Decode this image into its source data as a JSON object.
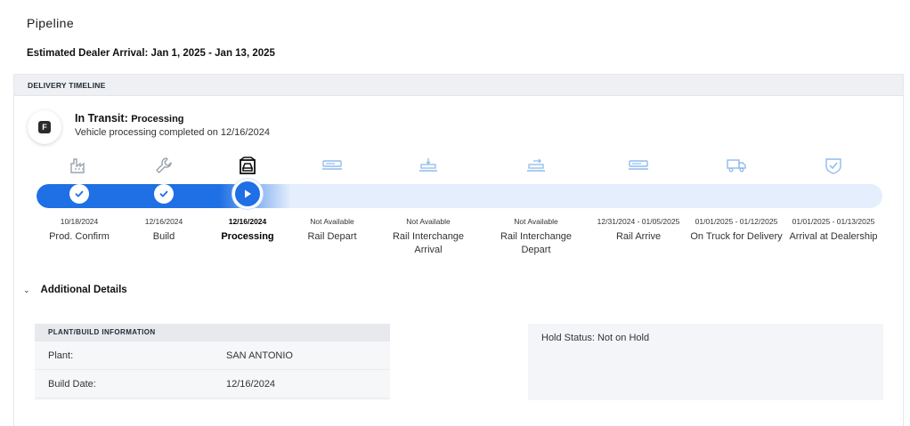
{
  "page": {
    "title": "Pipeline",
    "eta": "Estimated Dealer Arrival: Jan 1, 2025 - Jan 13, 2025"
  },
  "timeline": {
    "header": "DELIVERY TIMELINE",
    "status_logo": "F",
    "status_title": "In Transit:",
    "status_subtitle": "Processing",
    "status_desc": "Vehicle processing completed on 12/16/2024",
    "progress_fraction": 0.3,
    "steps": [
      {
        "date": "10/18/2024",
        "label": "Prod. Confirm",
        "state": "done",
        "icon": "factory-icon"
      },
      {
        "date": "12/16/2024",
        "label": "Build",
        "state": "done",
        "icon": "wrench-icon"
      },
      {
        "date": "12/16/2024",
        "label": "Processing",
        "state": "current",
        "icon": "vehicle-lift-icon"
      },
      {
        "date": "Not Available",
        "label": "Rail Depart",
        "state": "pending",
        "icon": "rail-car-icon"
      },
      {
        "date": "Not Available",
        "label": "Rail Interchange Arrival",
        "state": "pending",
        "icon": "rail-interchange-arrival-icon"
      },
      {
        "date": "Not Available",
        "label": "Rail Interchange Depart",
        "state": "pending",
        "icon": "rail-interchange-depart-icon"
      },
      {
        "date": "12/31/2024 - 01/05/2025",
        "label": "Rail Arrive",
        "state": "pending",
        "icon": "rail-arrive-icon"
      },
      {
        "date": "01/01/2025 - 01/12/2025",
        "label": "On Truck for Delivery",
        "state": "pending",
        "icon": "truck-icon"
      },
      {
        "date": "01/01/2025 - 01/13/2025",
        "label": "Arrival at Dealership",
        "state": "pending",
        "icon": "shield-check-icon"
      }
    ],
    "colors": {
      "accent": "#1f6fe5",
      "track": "#e4eefc",
      "done_icon": "#9aa3ad",
      "pending_icon": "#8fbbef"
    }
  },
  "additional": {
    "toggle_label": "Additional Details",
    "plant_card": {
      "header": "PLANT/BUILD INFORMATION",
      "rows": [
        {
          "key": "Plant:",
          "value": "SAN ANTONIO"
        },
        {
          "key": "Build Date:",
          "value": "12/16/2024"
        }
      ]
    },
    "hold_status": "Hold Status: Not on Hold"
  }
}
